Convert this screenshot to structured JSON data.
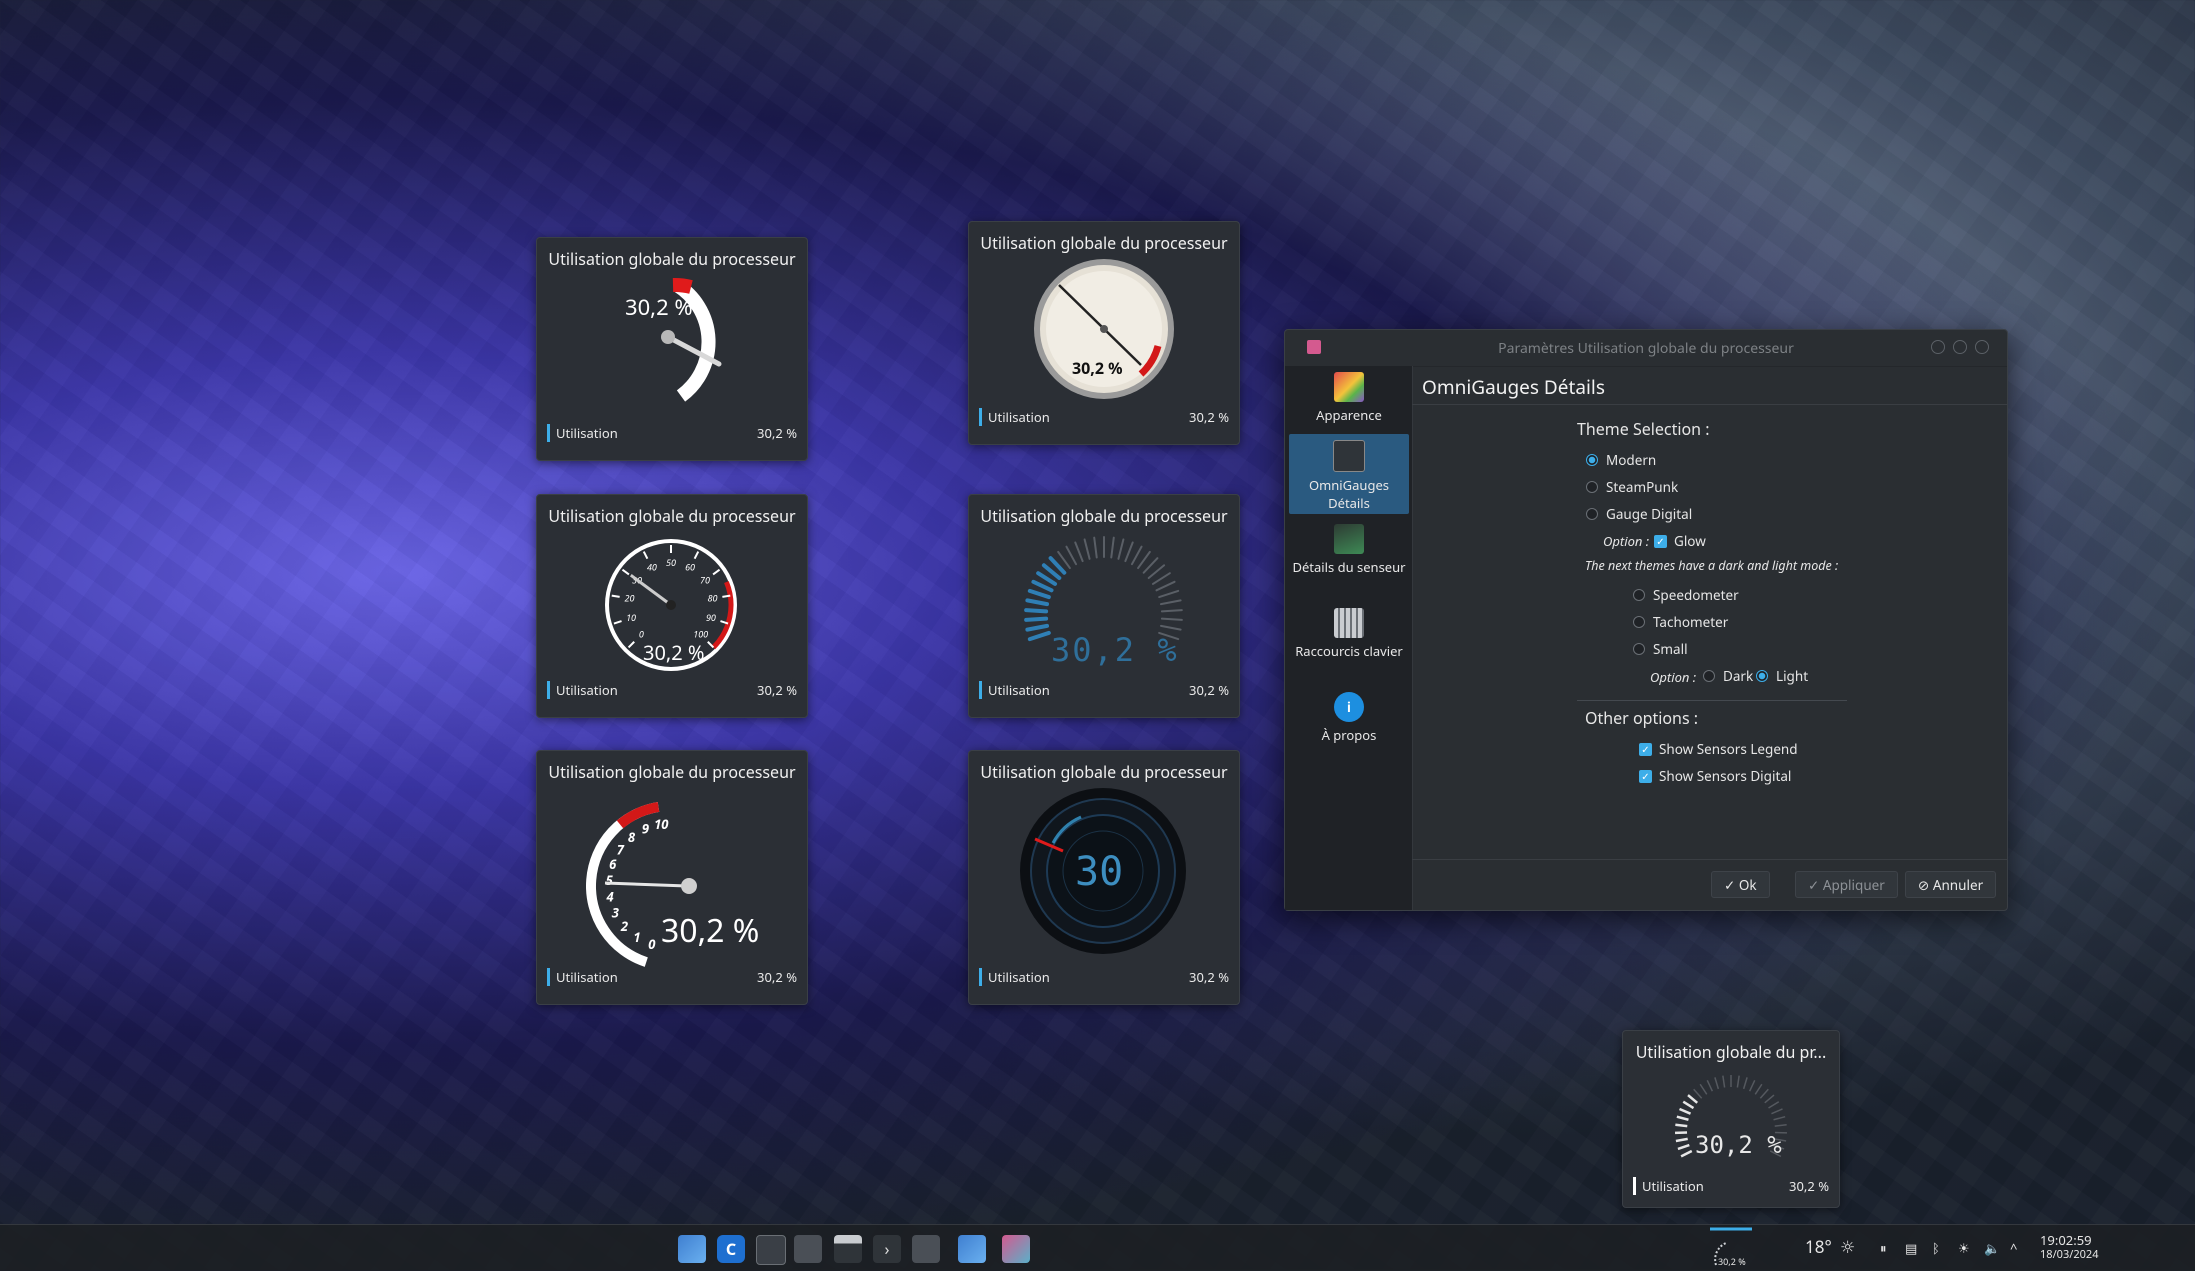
{
  "widgets": [
    {
      "id": "modern",
      "title": "Utilisation globale du processeur",
      "gauge_text": "30,2 %",
      "legend_name": "Utilisation",
      "legend_value": "30,2 %"
    },
    {
      "id": "steampunk",
      "title": "Utilisation globale du processeur",
      "gauge_text": "30,2 %",
      "legend_name": "Utilisation",
      "legend_value": "30,2 %"
    },
    {
      "id": "speedometer",
      "title": "Utilisation globale du processeur",
      "gauge_text": "30,2 %",
      "legend_name": "Utilisation",
      "legend_value": "30,2 %",
      "ticks": [
        "0",
        "10",
        "20",
        "30",
        "40",
        "50",
        "60",
        "70",
        "80",
        "90",
        "100"
      ]
    },
    {
      "id": "digital",
      "title": "Utilisation globale du processeur",
      "gauge_text": "30,2 %",
      "legend_name": "Utilisation",
      "legend_value": "30,2 %"
    },
    {
      "id": "tachometer",
      "title": "Utilisation globale du processeur",
      "gauge_text": "30,2 %",
      "legend_name": "Utilisation",
      "legend_value": "30,2 %",
      "ticks": [
        "0",
        "1",
        "2",
        "3",
        "4",
        "5",
        "6",
        "7",
        "8",
        "9",
        "10"
      ]
    },
    {
      "id": "glow",
      "title": "Utilisation globale du processeur",
      "gauge_text": "30",
      "legend_name": "Utilisation",
      "legend_value": "30,2 %"
    },
    {
      "id": "small",
      "title": "Utilisation globale du pr...",
      "gauge_text": "30,2 %",
      "legend_name": "Utilisation",
      "legend_value": "30,2 %"
    }
  ],
  "gauge_value_fraction": 0.302,
  "dialog": {
    "title": "Paramètres Utilisation globale du processeur",
    "sidebar": [
      {
        "label": "Apparence"
      },
      {
        "label": "OmniGauges Détails",
        "active": true
      },
      {
        "label": "Détails du senseur"
      },
      {
        "label": "Raccourcis clavier"
      },
      {
        "label": "À propos"
      }
    ],
    "header": "OmniGauges Détails",
    "theme_selection_label": "Theme Selection :",
    "themes": [
      "Modern",
      "SteamPunk",
      "Gauge Digital"
    ],
    "selected_theme": "Modern",
    "option_label": "Option :",
    "glow_label": "Glow",
    "dark_light_note": "The next themes have a dark and light mode :",
    "themes2": [
      "Speedometer",
      "Tachometer",
      "Small"
    ],
    "dark_label": "Dark",
    "light_label": "Light",
    "other_options_label": "Other options :",
    "show_legend": "Show Sensors Legend",
    "show_digital": "Show Sensors Digital",
    "ok": "Ok",
    "apply": "Appliquer",
    "cancel": "Annuler"
  },
  "taskbar": {
    "mini_gauge": "30,2 %",
    "temperature": "18°",
    "time": "19:02:59",
    "date": "18/03/2024"
  },
  "colors": {
    "accent": "#3daee9",
    "danger": "#d31818",
    "widget_bg": "#2b2f35"
  }
}
